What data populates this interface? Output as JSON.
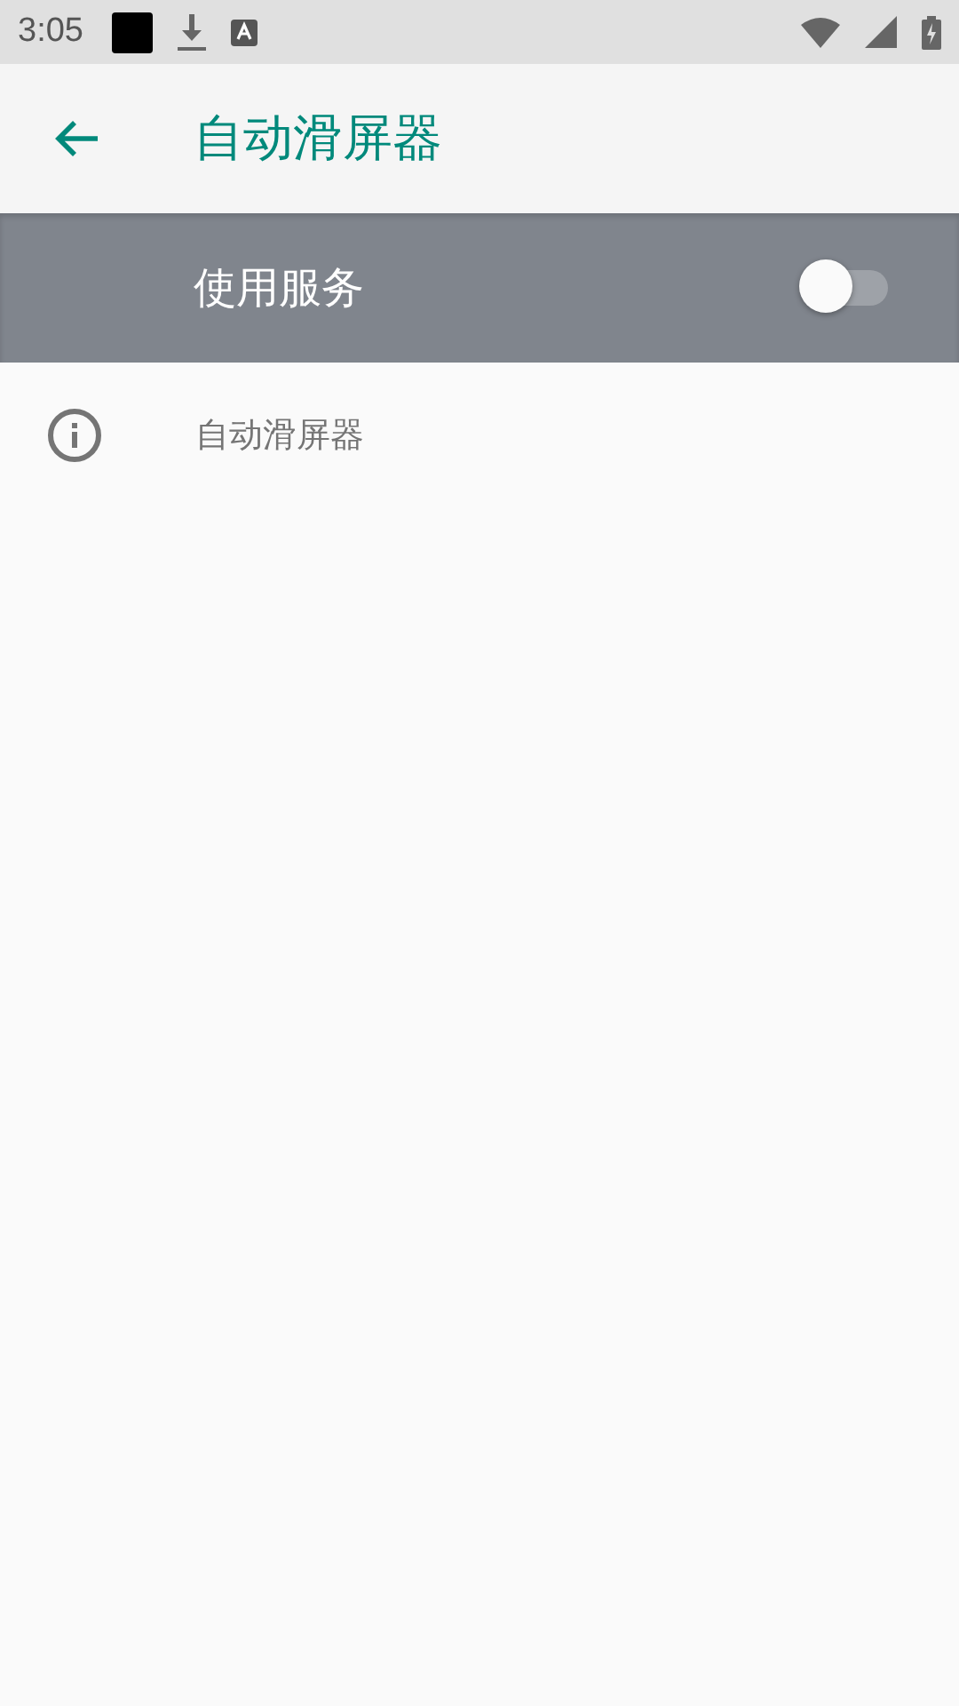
{
  "status_bar": {
    "time": "3:05"
  },
  "app_bar": {
    "title": "自动滑屏器"
  },
  "master_switch": {
    "label": "使用服务",
    "on": false
  },
  "info": {
    "text": "自动滑屏器"
  }
}
